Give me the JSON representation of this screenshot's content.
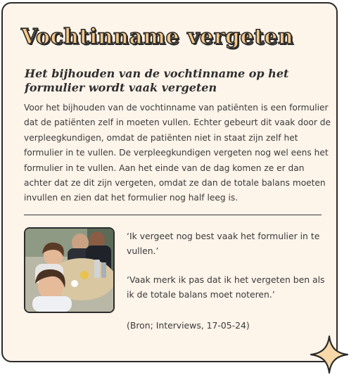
{
  "card": {
    "title": "Vochtinname vergeten",
    "subtitle": "Het bijhouden van de vochtinname op het formulier wordt vaak vergeten",
    "body": "Voor het bijhouden van de vochtinname van patiënten is een formulier dat de patiënten zelf in moeten vullen. Echter gebeurt dit vaak door de verpleegkundigen, omdat de patiënten niet in staat zijn zelf het formulier in te vullen. De verpleegkundigen vergeten nog wel eens het formulier in te vullen. Aan het einde van de dag komen ze er dan achter dat ze dit zijn vergeten, omdat ze dan de totale balans moeten invullen en zien dat het formulier nog half leeg is.",
    "quote_1": "‘Ik vergeet nog best vaak het formulier in te vullen.’",
    "quote_2": "‘Vaak merk ik pas dat ik het vergeten ben als ik de totale balans moet noteren.’",
    "source": "(Bron; Interviews, 17-05-24)"
  },
  "colors": {
    "card_background": "#fdf4ea",
    "title_fill": "#f7c98a",
    "outline": "#2b2b2b",
    "sparkle_fill": "#f8d8a8"
  },
  "icons": {
    "decoration": "sparkle-icon"
  }
}
